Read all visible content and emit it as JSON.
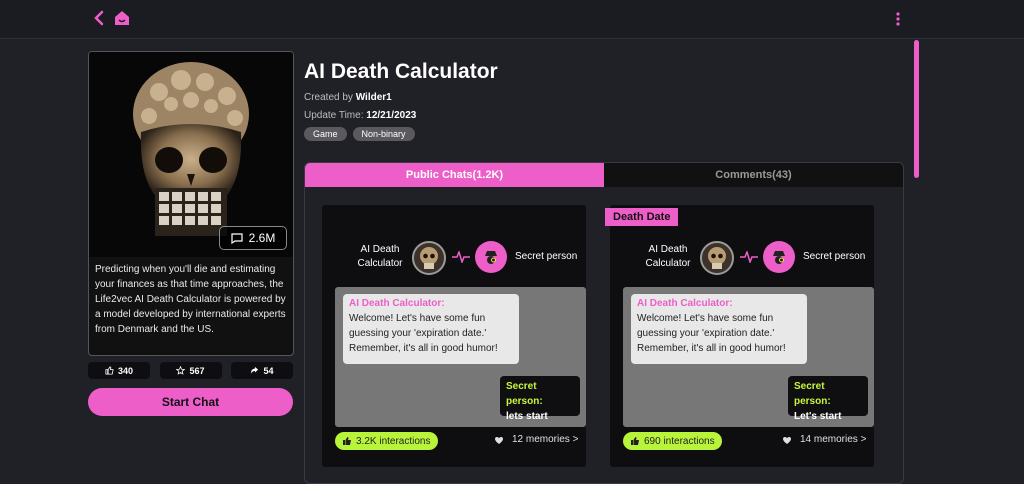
{
  "header": {
    "back_icon": "chevron-left-icon",
    "home_icon": "home-icon",
    "more_icon": "kebab-menu-icon",
    "accent": "#ee5ec9"
  },
  "character": {
    "title": "AI Death Calculator",
    "created_by_label": "Created by",
    "creator": "Wilder1",
    "update_label": "Update Time:",
    "update_time": "12/21/2023",
    "tags": [
      "Game",
      "Non-binary"
    ],
    "chat_count": "2.6M",
    "description": "Predicting when you'll die and estimating your finances as that time approaches, the Life2vec AI Death Calculator is powered by a model developed by international experts from Denmark and the US.",
    "likes": "340",
    "favorites": "567",
    "shares": "54",
    "start_chat_label": "Start Chat"
  },
  "tabs": [
    {
      "label": "Public Chats(1.2K)",
      "active": true
    },
    {
      "label": "Comments(43)",
      "active": false
    }
  ],
  "chats": [
    {
      "badge": "",
      "ai_name": "AI Death Calculator",
      "user_name": "Secret person",
      "ai_speaker": "AI Death Calculator:",
      "ai_message": "Welcome! Let's have some fun guessing your 'expiration date.' Remember, it's all in good humor!",
      "user_speaker": "Secret person:",
      "user_message": "lets start",
      "interactions": "3.2K interactions",
      "memories": "12 memories >"
    },
    {
      "badge": "Death Date",
      "ai_name": "AI Death Calculator",
      "user_name": "Secret person",
      "ai_speaker": "AI Death Calculator:",
      "ai_message": "Welcome! Let's have some fun guessing your 'expiration date.' Remember, it's all in good humor!",
      "user_speaker": "Secret person:",
      "user_message": "Let's start",
      "interactions": "690 interactions",
      "memories": "14 memories >"
    }
  ]
}
